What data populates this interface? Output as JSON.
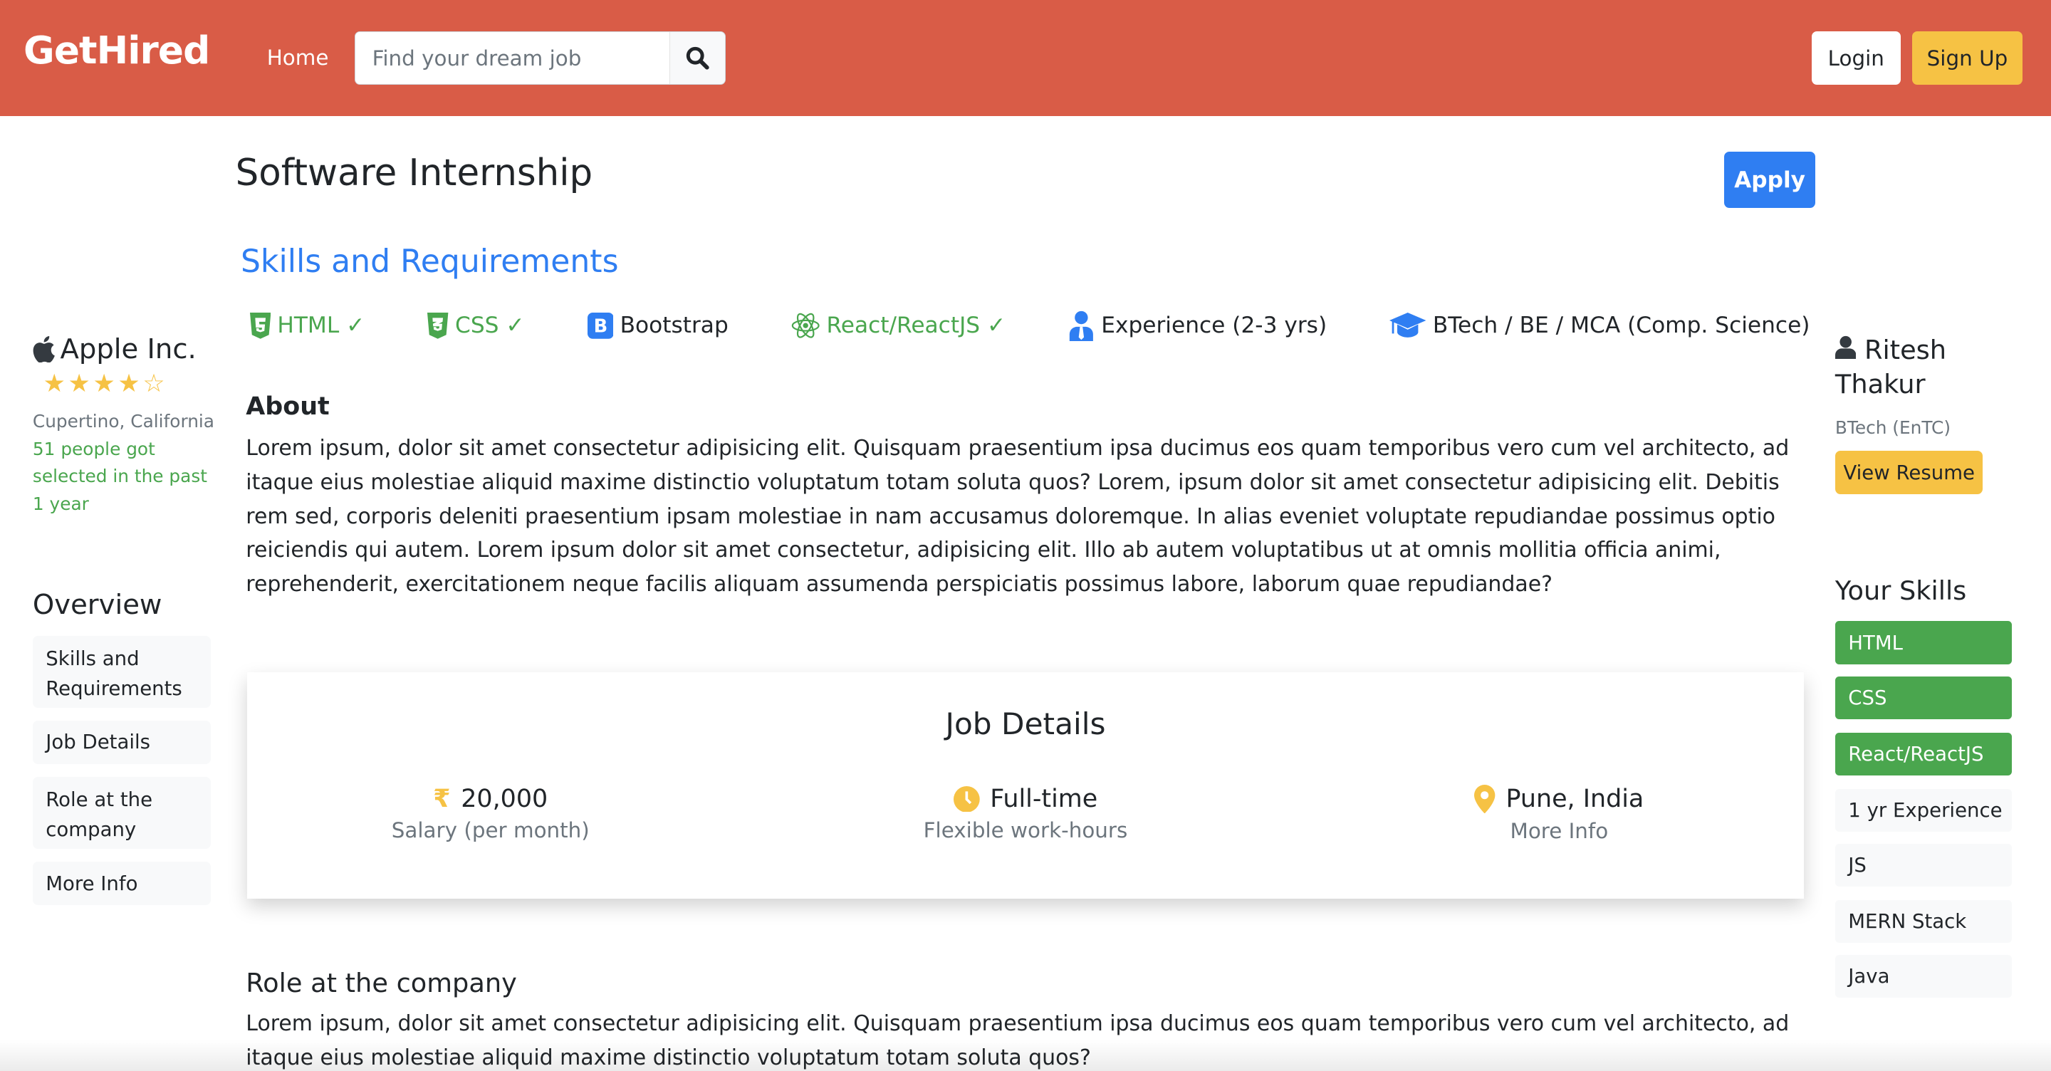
{
  "nav": {
    "brand": "GetHired",
    "home": "Home",
    "search_placeholder": "Find your dream job",
    "login": "Login",
    "signup": "Sign Up"
  },
  "job": {
    "title": "Software Internship",
    "apply": "Apply"
  },
  "skills": {
    "heading": "Skills and Requirements",
    "items": [
      {
        "label": "HTML ✓",
        "icon": "html5-icon",
        "matched": true
      },
      {
        "label": "CSS ✓",
        "icon": "css3-icon",
        "matched": true
      },
      {
        "label": "Bootstrap",
        "icon": "bootstrap-icon",
        "matched": false
      },
      {
        "label": "React/ReactJS ✓",
        "icon": "react-icon",
        "matched": true
      },
      {
        "label": "Experience (2-3 yrs)",
        "icon": "user-tie-icon",
        "matched": false
      },
      {
        "label": "BTech / BE / MCA (Comp. Science)",
        "icon": "graduation-cap-icon",
        "matched": false
      }
    ]
  },
  "company": {
    "name": "Apple Inc.",
    "rating": 4,
    "rating_max": 5,
    "location": "Cupertino, California",
    "selected": "51 people got selected in the past 1 year"
  },
  "overview": {
    "heading": "Overview",
    "items": [
      "Skills and Requirements",
      "Job Details",
      "Role at the company",
      "More Info"
    ]
  },
  "about": {
    "heading": "About",
    "text": "Lorem ipsum, dolor sit amet consectetur adipisicing elit. Quisquam praesentium ipsa ducimus eos quam temporibus vero cum vel architecto, ad itaque eius molestiae aliquid maxime distinctio voluptatum totam soluta quos? Lorem, ipsum dolor sit amet consectetur adipisicing elit. Debitis rem sed, corporis deleniti praesentium ipsam molestiae in nam accusamus doloremque. In alias eveniet voluptate repudiandae possimus optio reiciendis qui autem. Lorem ipsum dolor sit amet consectetur, adipisicing elit. Illo ab autem voluptatibus ut at omnis mollitia officia animi, reprehenderit, exercitationem neque facilis aliquam assumenda perspiciatis possimus labore, laborum quae repudiandae?"
  },
  "job_details": {
    "heading": "Job Details",
    "salary": "20,000",
    "salary_sub": "Salary (per month)",
    "type": "Full-time",
    "type_sub": "Flexible work-hours",
    "location": "Pune, India",
    "location_sub": "More Info"
  },
  "role": {
    "heading": "Role at the company",
    "text": "Lorem ipsum, dolor sit amet consectetur adipisicing elit. Quisquam praesentium ipsa ducimus eos quam temporibus vero cum vel architecto, ad itaque eius molestiae aliquid maxime distinctio voluptatum totam soluta quos?"
  },
  "user": {
    "name": "Ritesh Thakur",
    "degree": "BTech (EnTC)",
    "view_resume": "View Resume"
  },
  "your_skills": {
    "heading": "Your Skills",
    "items": [
      {
        "label": "HTML",
        "matched": true
      },
      {
        "label": "CSS",
        "matched": true
      },
      {
        "label": "React/ReactJS",
        "matched": true
      },
      {
        "label": "1 yr Experience",
        "matched": false
      },
      {
        "label": "JS",
        "matched": false
      },
      {
        "label": "MERN Stack",
        "matched": false
      },
      {
        "label": "Java",
        "matched": false
      }
    ]
  },
  "colors": {
    "navbar": "#d95c47",
    "primary": "#2f7ef2",
    "warning": "#f6c244",
    "success": "#4aa64e"
  }
}
